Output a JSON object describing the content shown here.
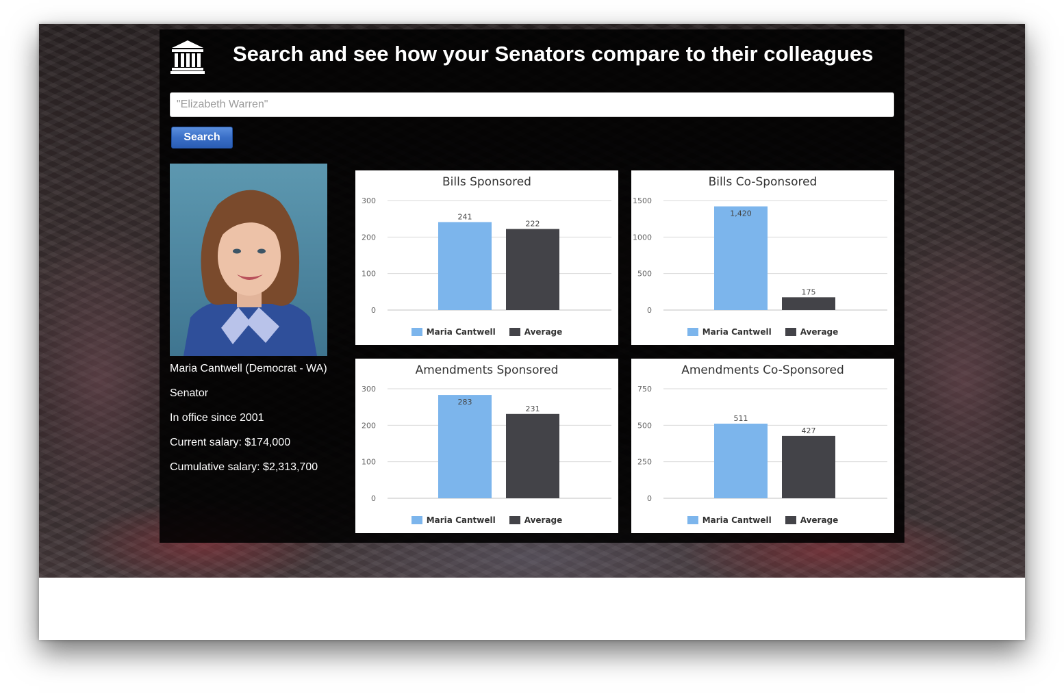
{
  "header": {
    "title": "Search and see how your Senators compare to their colleagues",
    "logo_icon": "capitol-building-icon"
  },
  "search": {
    "placeholder": "\"Elizabeth Warren\"",
    "button_label": "Search"
  },
  "senator": {
    "photo_alt": "Maria Cantwell",
    "name_line": "Maria Cantwell (Democrat - WA)",
    "position": "Senator",
    "in_office": "In office since 2001",
    "current_salary": "Current salary: $174,000",
    "cumulative_salary": "Cumulative salary: $2,313,700"
  },
  "colors": {
    "senator_bar": "#7cb5ec",
    "average_bar": "#434348",
    "panel_bg": "#000000",
    "button": "#3a6fc7"
  },
  "chart_data": [
    {
      "type": "bar",
      "title": "Bills Sponsored",
      "categories": [
        "Maria Cantwell",
        "Average"
      ],
      "series": [
        {
          "name": "Maria Cantwell",
          "values": [
            241
          ]
        },
        {
          "name": "Average",
          "values": [
            222
          ]
        }
      ],
      "yticks": [
        0,
        100,
        200,
        300
      ],
      "ylim": [
        0,
        300
      ],
      "data_labels_inside": false,
      "legend": "bottom"
    },
    {
      "type": "bar",
      "title": "Bills Co-Sponsored",
      "categories": [
        "Maria Cantwell",
        "Average"
      ],
      "series": [
        {
          "name": "Maria Cantwell",
          "values": [
            1420
          ]
        },
        {
          "name": "Average",
          "values": [
            175
          ]
        }
      ],
      "yticks": [
        0,
        500,
        1000,
        1500
      ],
      "ylim": [
        0,
        1500
      ],
      "data_labels": [
        "1,420",
        "175"
      ],
      "data_labels_inside": true,
      "legend": "bottom"
    },
    {
      "type": "bar",
      "title": "Amendments Sponsored",
      "categories": [
        "Maria Cantwell",
        "Average"
      ],
      "series": [
        {
          "name": "Maria Cantwell",
          "values": [
            283
          ]
        },
        {
          "name": "Average",
          "values": [
            231
          ]
        }
      ],
      "yticks": [
        0,
        100,
        200,
        300
      ],
      "ylim": [
        0,
        300
      ],
      "data_labels_inside": true,
      "legend": "bottom"
    },
    {
      "type": "bar",
      "title": "Amendments Co-Sponsored",
      "categories": [
        "Maria Cantwell",
        "Average"
      ],
      "series": [
        {
          "name": "Maria Cantwell",
          "values": [
            511
          ]
        },
        {
          "name": "Average",
          "values": [
            427
          ]
        }
      ],
      "yticks": [
        0,
        250,
        500,
        750
      ],
      "ylim": [
        0,
        750
      ],
      "data_labels_inside": false,
      "legend": "bottom"
    }
  ]
}
